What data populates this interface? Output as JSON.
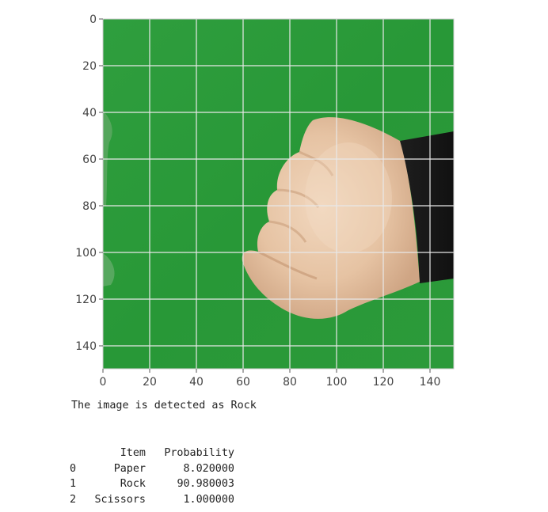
{
  "plot": {
    "image_alt": "Hand forming a fist (rock gesture) on green background",
    "x_ticks": [
      "0",
      "20",
      "40",
      "60",
      "80",
      "100",
      "120",
      "140"
    ],
    "y_ticks": [
      "0",
      "20",
      "40",
      "60",
      "80",
      "100",
      "120",
      "140"
    ],
    "background_color": "#2c9a3c",
    "grid_color": "#e8e8e8"
  },
  "result": {
    "text": "The image is detected as Rock"
  },
  "table": {
    "columns": [
      "",
      "Item",
      "Probability"
    ],
    "rows": [
      {
        "index": "0",
        "item": "Paper",
        "probability": "8.020000"
      },
      {
        "index": "1",
        "item": "Rock",
        "probability": "90.980003"
      },
      {
        "index": "2",
        "item": "Scissors",
        "probability": "1.000000"
      }
    ]
  }
}
